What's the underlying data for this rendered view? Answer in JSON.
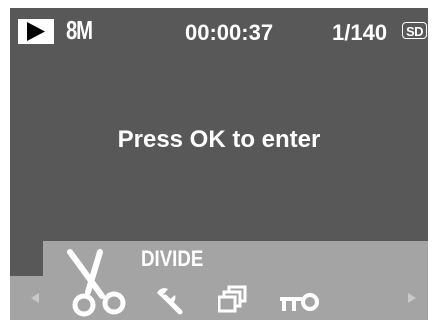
{
  "status_bar": {
    "mode_icon": "play-icon",
    "resolution": "8M",
    "time": "00:00:37",
    "counter": "1/140",
    "storage_icon": "SD"
  },
  "message": "Press OK to enter",
  "menu": {
    "selected_label": "DIVIDE",
    "items": [
      {
        "icon": "scissors-icon",
        "selected": true
      },
      {
        "icon": "wrench-icon",
        "selected": false
      },
      {
        "icon": "stacked-frames-icon",
        "selected": false
      },
      {
        "icon": "key-icon",
        "selected": false
      }
    ]
  },
  "colors": {
    "screen_bg": "#585858",
    "menu_bg": "#a4a4a4",
    "foreground": "#ffffff"
  }
}
